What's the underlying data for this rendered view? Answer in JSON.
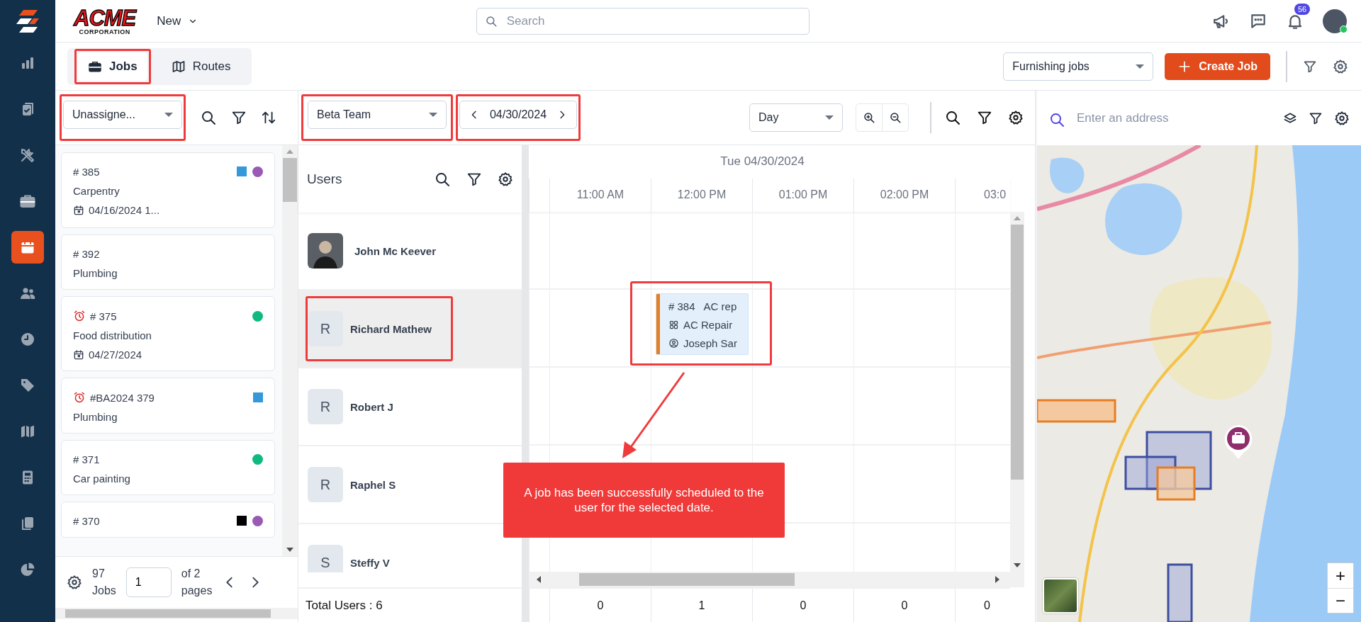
{
  "logo": {
    "text": "ACME",
    "subtext": "CORPORATION"
  },
  "sidebar": {
    "items": [
      {
        "selected": false
      },
      {
        "selected": false
      },
      {
        "selected": false
      },
      {
        "selected": false
      },
      {
        "selected": true
      },
      {
        "selected": false
      },
      {
        "selected": false
      },
      {
        "selected": false
      },
      {
        "selected": false
      },
      {
        "selected": false
      },
      {
        "selected": false
      },
      {
        "selected": false
      }
    ]
  },
  "header": {
    "new_menu": "New",
    "search_placeholder": "Search",
    "notification_count": "56"
  },
  "tabs": [
    {
      "label": "Jobs",
      "selected": true,
      "highlighted": true
    },
    {
      "label": "Routes",
      "selected": false,
      "highlighted": false
    }
  ],
  "job_type_select": "Furnishing jobs",
  "create_button": "Create Job",
  "jobs_panel": {
    "filter": {
      "value": "Unassigne...",
      "highlighted": true
    },
    "jobs": [
      {
        "number": "# 385",
        "title": "Carpentry",
        "date": "04/16/2024 1...",
        "alarm": false,
        "tags": [
          {
            "kind": "square",
            "color": "#3498db"
          },
          {
            "kind": "circle",
            "color": "#9b59b6"
          }
        ]
      },
      {
        "number": "# 392",
        "title": "Plumbing",
        "alarm": false
      },
      {
        "number": "# 375",
        "title": "Food distribution",
        "date": "04/27/2024",
        "alarm": true,
        "tags": [
          {
            "kind": "circle",
            "color": "#10b981"
          }
        ]
      },
      {
        "number": "#BA2024 379",
        "title": "Plumbing",
        "alarm": true,
        "tags": [
          {
            "kind": "square",
            "color": "#3498db"
          }
        ]
      },
      {
        "number": "# 371",
        "title": "Car painting",
        "alarm": false,
        "tags": [
          {
            "kind": "circle",
            "color": "#10b981"
          }
        ]
      },
      {
        "number": "# 370",
        "alarm": false,
        "tags": [
          {
            "kind": "square",
            "color": "#000000"
          },
          {
            "kind": "circle",
            "color": "#9b59b6"
          }
        ]
      }
    ],
    "total": "97",
    "total_label": "Jobs",
    "page": "1",
    "of_pages": "of 2",
    "pages_label": "pages"
  },
  "schedule": {
    "team": {
      "value": "Beta Team",
      "highlighted": true
    },
    "date": {
      "value": "04/30/2024",
      "highlighted": true
    },
    "view": "Day",
    "users_title": "Users",
    "day_header": "Tue 04/30/2024",
    "times": [
      "11:00 AM",
      "12:00 PM",
      "01:00 PM",
      "02:00 PM",
      "03:0"
    ],
    "users": [
      {
        "name": "John Mc Keever",
        "selected": false,
        "highlighted": false
      },
      {
        "name": "Richard Mathew",
        "initial": "R",
        "kind": "initial",
        "selected": true,
        "highlighted": true,
        "event": {
          "number": "# 384",
          "title": "AC rep",
          "type": "AC Repair",
          "assignee": "Joseph Sar",
          "color": "#e67e22",
          "highlighted": true
        }
      },
      {
        "name": "Robert J",
        "initial": "R",
        "kind": "initial",
        "selected": false,
        "highlighted": false
      },
      {
        "name": "Raphel S",
        "initial": "R",
        "kind": "initial",
        "selected": false,
        "highlighted": false
      },
      {
        "name": "Steffy V",
        "initial": "S",
        "kind": "initial",
        "selected": false,
        "highlighted": false
      }
    ],
    "total_users": "Total Users : 6",
    "counts": [
      "0",
      "1",
      "0",
      "0",
      "0"
    ]
  },
  "callout": "A job has been successfully scheduled to the user for the selected date.",
  "map": {
    "address_placeholder": "Enter an address",
    "zoom_in": "+",
    "zoom_out": "−"
  }
}
